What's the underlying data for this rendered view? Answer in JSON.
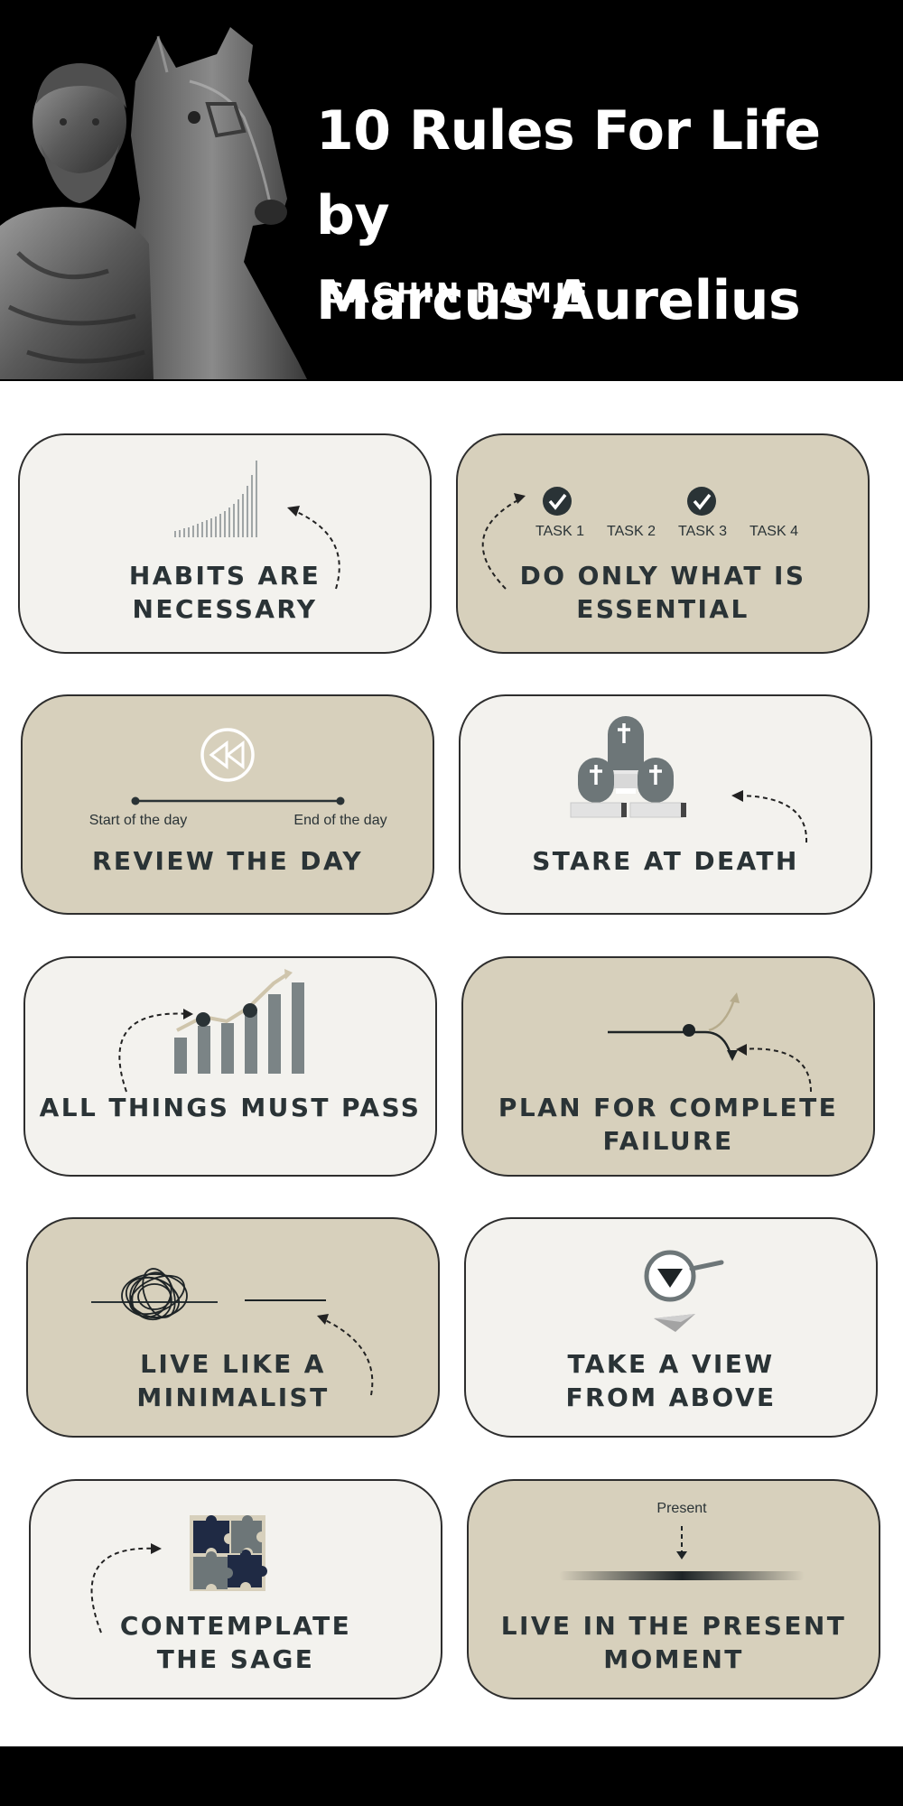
{
  "header": {
    "title_line1": "10 Rules For Life by",
    "title_line2": "Marcus Aurelius",
    "author": "SACHIN RAMJE"
  },
  "colors": {
    "header_bg": "#000000",
    "card_light": "#f3f2ee",
    "card_tan": "#d7d0bc",
    "text_dark": "#2a3336",
    "icon_gray": "#6d7678"
  },
  "rules": [
    {
      "line1": "HABITS ARE",
      "line2": "NECESSARY",
      "icon": "growth-bars-icon"
    },
    {
      "line1": "DO ONLY WHAT IS",
      "line2": "ESSENTIAL",
      "icon": "task-checklist-icon",
      "tasks": [
        "TASK 1",
        "TASK 2",
        "TASK 3",
        "TASK 4"
      ]
    },
    {
      "line1": "REVIEW THE DAY",
      "line2": "",
      "icon": "rewind-icon",
      "start_label": "Start of the day",
      "end_label": "End of the day"
    },
    {
      "line1": "STARE AT DEATH",
      "line2": "",
      "icon": "gravestones-icon"
    },
    {
      "line1": "ALL THINGS MUST PASS",
      "line2": "",
      "icon": "rising-chart-icon"
    },
    {
      "line1": "PLAN FOR COMPLETE",
      "line2": "FAILURE",
      "icon": "diverging-path-icon"
    },
    {
      "line1": "LIVE LIKE A",
      "line2": "MINIMALIST",
      "icon": "scribble-to-line-icon"
    },
    {
      "line1": "TAKE A VIEW",
      "line2": "FROM ABOVE",
      "icon": "magnifier-icon"
    },
    {
      "line1": "CONTEMPLATE",
      "line2": "THE SAGE",
      "icon": "puzzle-icon"
    },
    {
      "line1": "LIVE IN THE PRESENT",
      "line2": "MOMENT",
      "icon": "present-marker-icon",
      "present_label": "Present"
    }
  ]
}
